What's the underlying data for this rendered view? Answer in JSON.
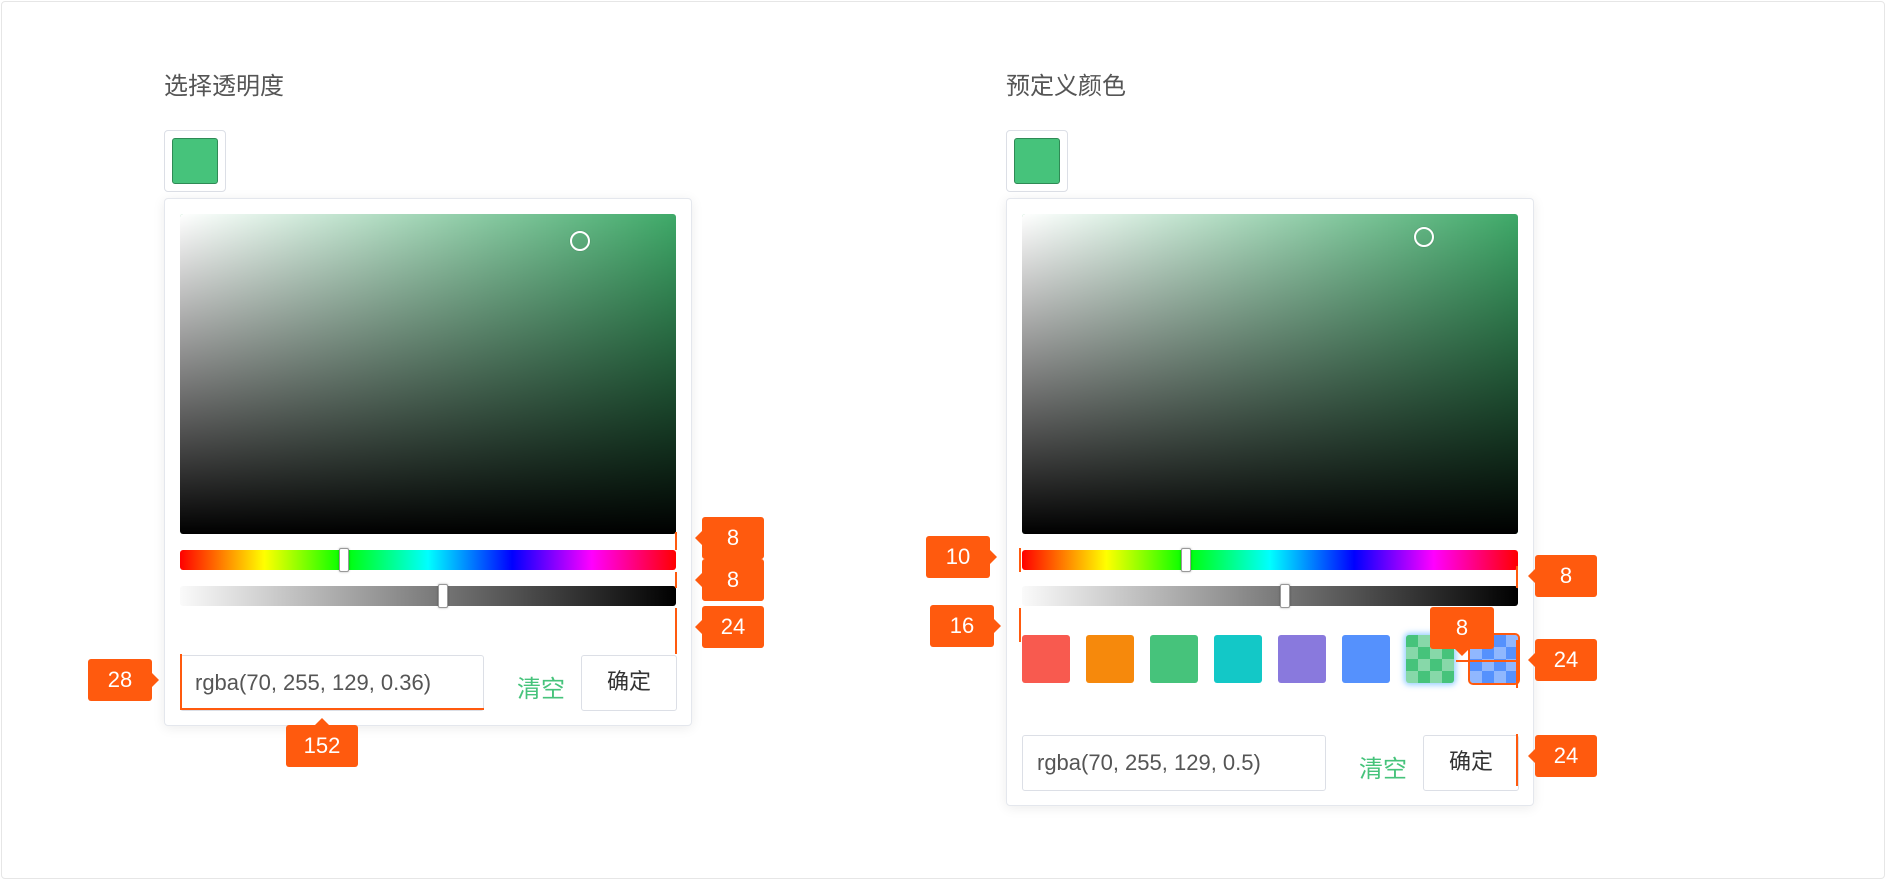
{
  "colors": {
    "green": "#46c37b",
    "annotation": "#ff5a0e"
  },
  "left": {
    "title": "选择透明度",
    "trigger_color": "#46c37b",
    "input_value": "rgba(70, 255, 129, 0.36)",
    "clear_label": "清空",
    "ok_label": "确定",
    "hue_position": 0.33,
    "alpha_position": 0.53,
    "annotations": {
      "hue_gap": "8",
      "alpha_gap": "8",
      "bottom_gap": "24",
      "input_height": "28",
      "input_width": "152"
    }
  },
  "right": {
    "title": "预定义颜色",
    "trigger_color": "#46c37b",
    "input_value": "rgba(70, 255, 129, 0.5)",
    "clear_label": "清空",
    "ok_label": "确定",
    "hue_position": 0.33,
    "alpha_position": 0.53,
    "presets": [
      {
        "name": "red",
        "color": "#f85a4f"
      },
      {
        "name": "orange",
        "color": "#f6890c"
      },
      {
        "name": "green",
        "color": "#46c37b"
      },
      {
        "name": "cyan",
        "color": "#13c8c7"
      },
      {
        "name": "purple",
        "color": "#8979dd"
      },
      {
        "name": "blue",
        "color": "#5591fd"
      },
      {
        "name": "green-alpha",
        "color": "#46c37b"
      },
      {
        "name": "blue-alpha",
        "color": "#5591fd"
      }
    ],
    "annotations": {
      "left_padding": "10",
      "alpha_gap": "8",
      "presets_indent": "16",
      "preset_gap": "8",
      "preset_size": "24",
      "button_height": "24"
    }
  }
}
